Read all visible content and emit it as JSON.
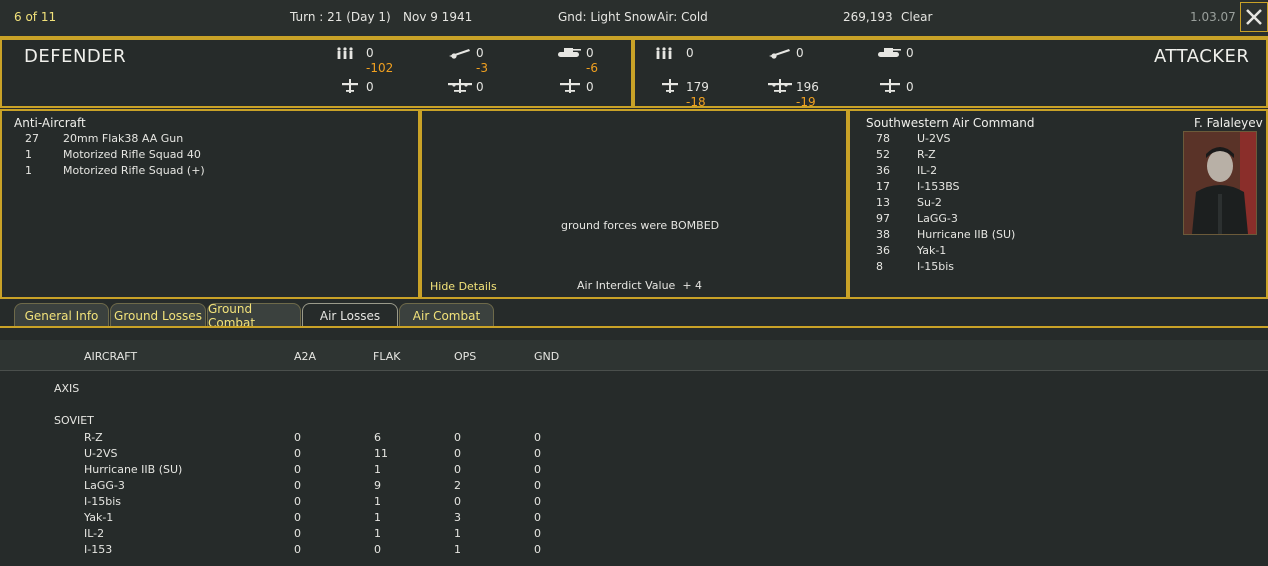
{
  "header": {
    "counter": "6 of 11",
    "turn": "Turn : 21 (Day 1)",
    "date": "Nov 9 1941",
    "ground": "Gnd: Light Snow",
    "air": "Air: Cold",
    "number": "269,193",
    "weather": "Clear",
    "version": "1.03.07"
  },
  "defender": {
    "title": "DEFENDER",
    "men": "0",
    "men_loss": "-102",
    "aircraft_a": "0",
    "aircraft_a_loss": "-3",
    "tanks": "0",
    "tanks_loss": "-6",
    "fighters": "0",
    "bombers": "0",
    "other": "0"
  },
  "attacker": {
    "title": "ATTACKER",
    "men": "0",
    "aircraft_a": "0",
    "tanks": "0",
    "fighters": "179",
    "fighters_loss": "-18",
    "bombers": "196",
    "bombers_loss": "-19",
    "other": "0"
  },
  "left_panel": {
    "title": "Anti-Aircraft",
    "rows": [
      {
        "count": "27",
        "name": "20mm Flak38 AA Gun"
      },
      {
        "count": "1",
        "name": "Motorized Rifle Squad 40"
      },
      {
        "count": "1",
        "name": "Motorized Rifle Squad (+)"
      }
    ]
  },
  "middle_panel": {
    "message": "ground forces were BOMBED",
    "hide_details": "Hide Details",
    "interdict": "Air Interdict Value  + 4"
  },
  "right_panel": {
    "title": "Southwestern Air Command",
    "commander": "F. Falaleyev",
    "rows": [
      {
        "count": "78",
        "name": "U-2VS"
      },
      {
        "count": "52",
        "name": "R-Z"
      },
      {
        "count": "36",
        "name": "IL-2"
      },
      {
        "count": "17",
        "name": "I-153BS"
      },
      {
        "count": "13",
        "name": "Su-2"
      },
      {
        "count": "97",
        "name": "LaGG-3"
      },
      {
        "count": "38",
        "name": "Hurricane IIB (SU)"
      },
      {
        "count": "36",
        "name": "Yak-1"
      },
      {
        "count": "8",
        "name": "I-15bis"
      }
    ]
  },
  "tabs": [
    {
      "label": "General Info"
    },
    {
      "label": "Ground Losses"
    },
    {
      "label": "Ground Combat"
    },
    {
      "label": "Air Losses"
    },
    {
      "label": "Air Combat"
    }
  ],
  "losses_table": {
    "headers": [
      "AIRCRAFT",
      "A2A",
      "FLAK",
      "OPS",
      "GND"
    ],
    "axis_label": "AXIS",
    "soviet_label": "SOVIET",
    "rows": [
      {
        "name": "R-Z",
        "a2a": "0",
        "flak": "6",
        "ops": "0",
        "gnd": "0"
      },
      {
        "name": "U-2VS",
        "a2a": "0",
        "flak": "11",
        "ops": "0",
        "gnd": "0"
      },
      {
        "name": "Hurricane IIB (SU)",
        "a2a": "0",
        "flak": "1",
        "ops": "0",
        "gnd": "0"
      },
      {
        "name": "LaGG-3",
        "a2a": "0",
        "flak": "9",
        "ops": "2",
        "gnd": "0"
      },
      {
        "name": "I-15bis",
        "a2a": "0",
        "flak": "1",
        "ops": "0",
        "gnd": "0"
      },
      {
        "name": "Yak-1",
        "a2a": "0",
        "flak": "1",
        "ops": "3",
        "gnd": "0"
      },
      {
        "name": "IL-2",
        "a2a": "0",
        "flak": "1",
        "ops": "1",
        "gnd": "0"
      },
      {
        "name": "I-153",
        "a2a": "0",
        "flak": "0",
        "ops": "1",
        "gnd": "0"
      }
    ]
  },
  "colors": {
    "accent": "#c9a227",
    "loss": "#f0a020",
    "tab_text": "#f2e27a",
    "background": "#262b2a"
  }
}
